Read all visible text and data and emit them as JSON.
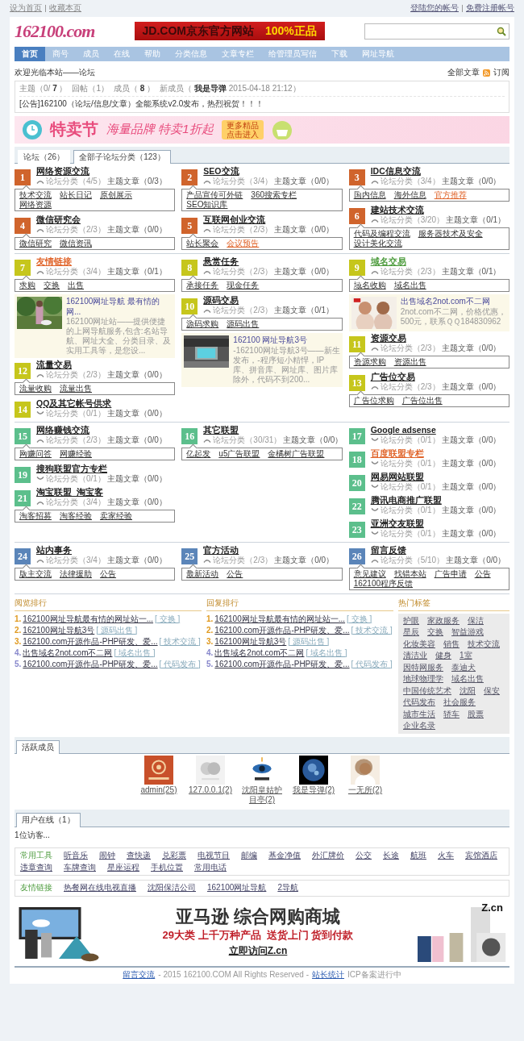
{
  "top_links": {
    "left": [
      "设为首页",
      "收藏本页"
    ],
    "right": [
      "登陆您的帐号",
      "免费注册帐号"
    ]
  },
  "header": {
    "logo": "162100.com",
    "ad": {
      "text": "JD.COM京东官方网站",
      "tag": "100%正品"
    }
  },
  "nav": [
    {
      "label": "首页",
      "selected": true
    },
    {
      "label": "商号",
      "selected": false
    },
    {
      "label": "成员",
      "selected": false
    },
    {
      "label": "在线",
      "selected": false
    },
    {
      "label": "帮助",
      "selected": false
    },
    {
      "label": "分类信息",
      "selected": false
    },
    {
      "label": "文章专栏",
      "selected": false
    },
    {
      "label": "给管理员写信",
      "selected": false
    },
    {
      "label": "下载",
      "selected": false
    },
    {
      "label": "网址导航",
      "selected": false
    }
  ],
  "welcome": {
    "text": "欢迎光临本站——论坛",
    "all_articles": "全部文章",
    "subscribe": "订阅"
  },
  "stats": [
    "主题（0/ **7** ）",
    "回帖（1）",
    "成员（ **8** ）",
    "新成员（ **我是导弹** 2015-04-18 21:12）"
  ],
  "notice": "[公告]162100（论坛/信息/文章）全能系统v2.0发布，热烈祝贺！！！",
  "promo_banner": {
    "title": "特卖节",
    "slogan": "海量品牌 特卖1折起",
    "button": "更多精品点击进入"
  },
  "forum_tabs": [
    {
      "label": "论坛（26）",
      "selected": false
    },
    {
      "label": "全部子论坛分类（123）",
      "selected": true
    }
  ],
  "groups": [
    {
      "color": "#d0642c",
      "columns": [
        [
          {
            "kind": "forum",
            "number": "1",
            "title": "网络资源交流",
            "stats": "论坛分类（4/5）",
            "posts": "主题文章（0/3）",
            "expanded": true,
            "subs": [
              {
                "label": "技术交流",
                "highlighted": false
              },
              {
                "label": "站长日记",
                "highlighted": false
              },
              {
                "label": "原创展示",
                "highlighted": false
              },
              {
                "label": "网络资源",
                "highlighted": false
              }
            ]
          },
          {
            "kind": "forum",
            "number": "4",
            "title": "微信研究会",
            "stats": "论坛分类（2/3）",
            "posts": "主题文章（0/0）",
            "expanded": true,
            "subs": [
              {
                "label": "微信研究",
                "highlighted": false
              },
              {
                "label": "微信资讯",
                "highlighted": false
              }
            ]
          }
        ],
        [
          {
            "kind": "forum",
            "number": "2",
            "title": "SEO交流",
            "stats": "论坛分类（3/4）",
            "posts": "主题文章（0/0）",
            "expanded": true,
            "subs": [
              {
                "label": "产品宣传可外链",
                "highlighted": false
              },
              {
                "label": "360搜索专栏",
                "highlighted": false
              },
              {
                "label": "SEO知识库",
                "highlighted": false
              }
            ]
          },
          {
            "kind": "forum",
            "number": "5",
            "title": "互联网创业交流",
            "stats": "论坛分类（2/3）",
            "posts": "主题文章（0/0）",
            "expanded": true,
            "subs": [
              {
                "label": "站长聚会",
                "highlighted": false
              },
              {
                "label": "会议预告",
                "highlighted": true
              }
            ]
          }
        ],
        [
          {
            "kind": "forum",
            "number": "3",
            "title": "IDC信息交流",
            "stats": "论坛分类（3/4）",
            "posts": "主题文章（0/0）",
            "expanded": true,
            "subs": [
              {
                "label": "国内信息",
                "highlighted": false
              },
              {
                "label": "海外信息",
                "highlighted": false
              },
              {
                "label": "官方推荐",
                "highlighted": true
              }
            ]
          },
          {
            "kind": "forum",
            "number": "6",
            "title": "建站技术交流",
            "stats": "论坛分类（3/20）",
            "posts": "主题文章（0/1）",
            "expanded": true,
            "subs": [
              {
                "label": "代码及编程交流",
                "highlighted": false
              },
              {
                "label": "服务器技术及安全",
                "highlighted": false
              },
              {
                "label": "设计美化交流",
                "highlighted": false
              }
            ]
          }
        ]
      ]
    },
    {
      "color": "#c6c61c",
      "columns": [
        [
          {
            "kind": "forum",
            "number": "7",
            "title": "友情链接",
            "color": "#e0642a",
            "stats": "论坛分类（3/4）",
            "posts": "主题文章（0/1）",
            "expanded": true,
            "subs": [
              {
                "label": "求购",
                "highlighted": false
              },
              {
                "label": "交换",
                "highlighted": false
              },
              {
                "label": "出售",
                "highlighted": false
              }
            ]
          },
          {
            "kind": "promo",
            "title": "162100网址导航 最有情的网...",
            "text": "162100网址站——提供便捷的上网导航服务,包含:名站导航、网址大全、分类目录、及实用工具等，是您设..."
          },
          {
            "kind": "forum",
            "number": "12",
            "title": "流量交易",
            "stats": "论坛分类（2/3）",
            "posts": "主题文章（0/0）",
            "expanded": true,
            "subs": [
              {
                "label": "流量收购",
                "highlighted": false
              },
              {
                "label": "流量出售",
                "highlighted": false
              }
            ]
          },
          {
            "kind": "forum",
            "number": "14",
            "title": "QQ及其它帐号供求",
            "stats": "论坛分类（0/1）",
            "posts": "主题文章（0/0）",
            "expanded": false
          }
        ],
        [
          {
            "kind": "forum",
            "number": "8",
            "title": "悬赏任务",
            "stats": "论坛分类（2/3）",
            "posts": "主题文章（0/0）",
            "expanded": true,
            "subs": [
              {
                "label": "承接任务",
                "highlighted": false
              },
              {
                "label": "现金任务",
                "highlighted": false
              }
            ]
          },
          {
            "kind": "forum",
            "number": "10",
            "title": "源码交易",
            "stats": "论坛分类（2/3）",
            "posts": "主题文章（0/1）",
            "expanded": true,
            "subs": [
              {
                "label": "源码求购",
                "highlighted": false
              },
              {
                "label": "源码出售",
                "highlighted": false
              }
            ]
          },
          {
            "kind": "promo",
            "title": "162100 网址导航3号",
            "text": "-162100网址导航3号——新生发布，-程序短小精悍，IP库、拼音库、网址库、图片库除外，代码不到200..."
          }
        ],
        [
          {
            "kind": "forum",
            "number": "9",
            "title": "域名交易",
            "color": "#4a9a3a",
            "stats": "论坛分类（2/3）",
            "posts": "主题文章（0/1）",
            "expanded": true,
            "subs": [
              {
                "label": "域名收购",
                "highlighted": false
              },
              {
                "label": "域名出售",
                "highlighted": false
              }
            ]
          },
          {
            "kind": "promo",
            "title": "出售域名2not.com不二网",
            "text": "2not.com不二网，价格优惠，500元，联系ＱＱ184830962"
          },
          {
            "kind": "forum",
            "number": "11",
            "title": "资源交易",
            "stats": "论坛分类（2/3）",
            "posts": "主题文章（0/0）",
            "expanded": true,
            "subs": [
              {
                "label": "资源求购",
                "highlighted": false
              },
              {
                "label": "资源出售",
                "highlighted": false
              }
            ]
          },
          {
            "kind": "forum",
            "number": "13",
            "title": "广告位交易",
            "stats": "论坛分类（2/3）",
            "posts": "主题文章（0/0）",
            "expanded": true,
            "subs": [
              {
                "label": "广告位求购",
                "highlighted": false
              },
              {
                "label": "广告位出售",
                "highlighted": false
              }
            ]
          }
        ]
      ]
    },
    {
      "color": "#5cbf8c",
      "columns": [
        [
          {
            "kind": "forum",
            "number": "15",
            "title": "网络赚钱交流",
            "stats": "论坛分类（2/3）",
            "posts": "主题文章（0/0）",
            "expanded": true,
            "subs": [
              {
                "label": "网赚问答",
                "highlighted": false
              },
              {
                "label": "网赚经验",
                "highlighted": false
              }
            ]
          },
          {
            "kind": "forum",
            "number": "19",
            "title": "搜狗联盟官方专栏",
            "stats": "论坛分类（0/1）",
            "posts": "主题文章（0/0）",
            "expanded": false
          },
          {
            "kind": "forum",
            "number": "21",
            "title": "淘宝联盟_淘宝客",
            "stats": "论坛分类（3/4）",
            "posts": "主题文章（0/0）",
            "expanded": true,
            "subs": [
              {
                "label": "淘客招募",
                "highlighted": false
              },
              {
                "label": "淘客经验",
                "highlighted": false
              },
              {
                "label": "卖家经验",
                "highlighted": false
              }
            ]
          }
        ],
        [
          {
            "kind": "forum",
            "number": "16",
            "title": "其它联盟",
            "stats": "论坛分类（30/31）",
            "posts": "主题文章（0/0）",
            "expanded": true,
            "subs": [
              {
                "label": "亿起发",
                "highlighted": false
              },
              {
                "label": "u5广告联盟",
                "highlighted": false
              },
              {
                "label": "金橘树广告联盟",
                "highlighted": false
              }
            ]
          }
        ],
        [
          {
            "kind": "forum",
            "number": "17",
            "title": "Google adsense",
            "stats": "论坛分类（0/1）",
            "posts": "主题文章（0/0）",
            "expanded": false
          },
          {
            "kind": "forum",
            "number": "18",
            "title": "百度联盟专栏",
            "color": "#e0642a",
            "stats": "论坛分类（0/1）",
            "posts": "主题文章（0/0）",
            "expanded": false
          },
          {
            "kind": "forum",
            "number": "20",
            "title": "网易网站联盟",
            "stats": "论坛分类（0/1）",
            "posts": "主题文章（0/0）",
            "expanded": false
          },
          {
            "kind": "forum",
            "number": "22",
            "title": "腾讯电商推广联盟",
            "stats": "论坛分类（0/1）",
            "posts": "主题文章（0/0）",
            "expanded": false
          },
          {
            "kind": "forum",
            "number": "23",
            "title": "亚洲交友联盟",
            "stats": "论坛分类（0/1）",
            "posts": "主题文章（0/0）",
            "expanded": false
          }
        ]
      ]
    },
    {
      "color": "#5b85b9",
      "columns": [
        [
          {
            "kind": "forum",
            "number": "24",
            "title": "站内事务",
            "stats": "论坛分类（3/4）",
            "posts": "主题文章（0/0）",
            "expanded": true,
            "subs": [
              {
                "label": "版主交流",
                "highlighted": false
              },
              {
                "label": "法律援助",
                "highlighted": false
              },
              {
                "label": "公告",
                "highlighted": false
              }
            ]
          }
        ],
        [
          {
            "kind": "forum",
            "number": "25",
            "title": "官方活动",
            "stats": "论坛分类（2/3）",
            "posts": "主题文章（0/0）",
            "expanded": true,
            "subs": [
              {
                "label": "最新活动",
                "highlighted": false
              },
              {
                "label": "公告",
                "highlighted": false
              }
            ]
          }
        ],
        [
          {
            "kind": "forum",
            "number": "26",
            "title": "留言反馈",
            "stats": "论坛分类（5/10）",
            "posts": "主题文章（0/0）",
            "expanded": true,
            "subs": [
              {
                "label": "意见建议",
                "highlighted": false
              },
              {
                "label": "找错本站",
                "highlighted": false
              },
              {
                "label": "广告申请",
                "highlighted": false
              },
              {
                "label": "公告",
                "highlighted": false
              },
              {
                "label": "162100程序反馈",
                "highlighted": false
              }
            ]
          }
        ]
      ]
    }
  ],
  "rankings": [
    {
      "title": "阅览排行",
      "items": [
        {
          "rank": "1.",
          "title": "162100网址导航最有情的网址站一...",
          "tag": "[ 交换 ]",
          "top": true
        },
        {
          "rank": "2.",
          "title": "162100网址导航3号",
          "tag": "[ 源码出售 ]",
          "top": true
        },
        {
          "rank": "3.",
          "title": "162100.com开源作品-PHP研发、爱...",
          "tag": "[ 技术交流 ]",
          "top": true
        },
        {
          "rank": "4.",
          "title": "出售域名2not.com不二网",
          "tag": "[ 域名出售 ]",
          "top": false
        },
        {
          "rank": "5.",
          "title": "162100.com开源作品-PHP研发、爱...",
          "tag": "[ 代码发布 ]",
          "top": false
        }
      ]
    },
    {
      "title": "回复排行",
      "items": [
        {
          "rank": "1.",
          "title": "162100网址导航最有情的网址站一...",
          "tag": "[ 交换 ]",
          "top": true
        },
        {
          "rank": "2.",
          "title": "162100.com开源作品-PHP研发、爱...",
          "tag": "[ 技术交流 ]",
          "top": true
        },
        {
          "rank": "3.",
          "title": "162100网址导航3号",
          "tag": "[ 源码出售 ]",
          "top": true
        },
        {
          "rank": "4.",
          "title": "出售域名2not.com不二网",
          "tag": "[ 域名出售 ]",
          "top": false
        },
        {
          "rank": "5.",
          "title": "162100.com开源作品-PHP研发、爱...",
          "tag": "[ 代码发布 ]",
          "top": false
        }
      ]
    }
  ],
  "hot_tags": {
    "title": "热门标签",
    "tags": [
      "护眼",
      "家政服务",
      "保洁",
      "星辰",
      "交换",
      "智益游戏",
      "化妆美容",
      "销售",
      "技术交流",
      "清洁业",
      "健身",
      "1室",
      "因特网服务",
      "泰迪犬",
      "地球物理学",
      "域名出售",
      "中国传统艺术",
      "沈阳",
      "保安",
      "代码发布",
      "社会服务",
      "城市生活",
      "轿车",
      "股票",
      "企业名录"
    ]
  },
  "active_members": {
    "tab": "活跃成员",
    "members": [
      "admin(25)",
      "127.0.0.1(2)",
      "沈阳皇姑护目亭(2)",
      "我是导弹(2)",
      "一无所(2)"
    ]
  },
  "online": {
    "tab": "用户在线（1）",
    "text": "1位访客..."
  },
  "tools": {
    "label": "常用工具",
    "links": [
      "听音乐",
      "闹钟",
      "查快递",
      "兑彩票",
      "电视节目",
      "邮编",
      "基金净值",
      "外汇牌价",
      "公交",
      "长途",
      "航班",
      "火车",
      "宾馆酒店",
      "违章查询",
      "车牌查询",
      "星座运程",
      "手机位置",
      "常用电话"
    ]
  },
  "friend_links": {
    "label": "友情链接",
    "links": [
      "热餐网在线电视直播",
      "沈阳保洁公司",
      "162100网址导航",
      "2导航"
    ]
  },
  "amazon_banner": {
    "logo": "Z.cn",
    "title": "亚马逊 综合网购商城",
    "subtitle": "29大类 上千万种产品  送货上门 货到付款",
    "cta": "立即访问Z.cn"
  },
  "footer": [
    {
      "kind": "link",
      "label": "留言交流"
    },
    {
      "kind": "text",
      "label": "- 2015 162100.COM All Rights Reserved -"
    },
    {
      "kind": "link",
      "label": "站长统计"
    },
    {
      "kind": "text",
      "label": "ICP备案进行中"
    }
  ]
}
